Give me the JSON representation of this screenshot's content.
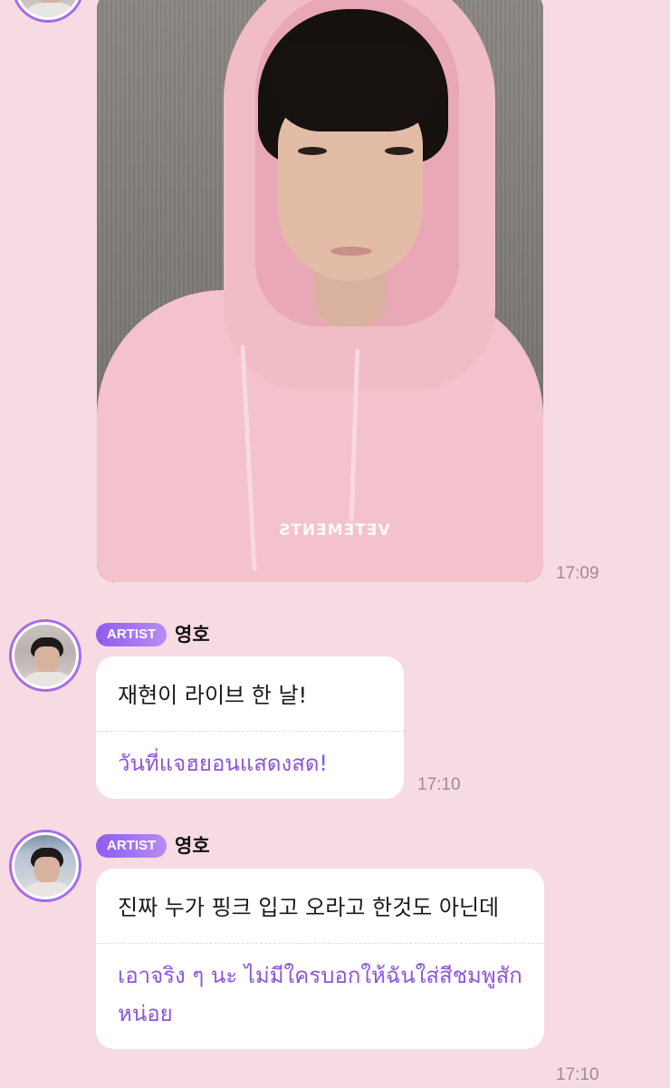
{
  "photo_message": {
    "time": "17:09",
    "logo_text": "VETEMENTS"
  },
  "messages": [
    {
      "badge": "ARTIST",
      "sender": "영호",
      "text": "재현이 라이브 한 날!",
      "translation": "วันที่แจฮยอนแสดงสด!",
      "time": "17:10"
    },
    {
      "badge": "ARTIST",
      "sender": "영호",
      "text": "진짜 누가 핑크 입고 오라고 한것도 아닌데",
      "translation": "เอาจริง ๆ นะ ไม่มีใครบอกให้ฉันใส่สีชมพูสักหน่อย",
      "time": "17:10"
    }
  ],
  "colors": {
    "background": "#f7dbe2",
    "badge": "#8d5cf0",
    "translation_text": "#8e55d9",
    "avatar_ring": "#a76ce8"
  }
}
